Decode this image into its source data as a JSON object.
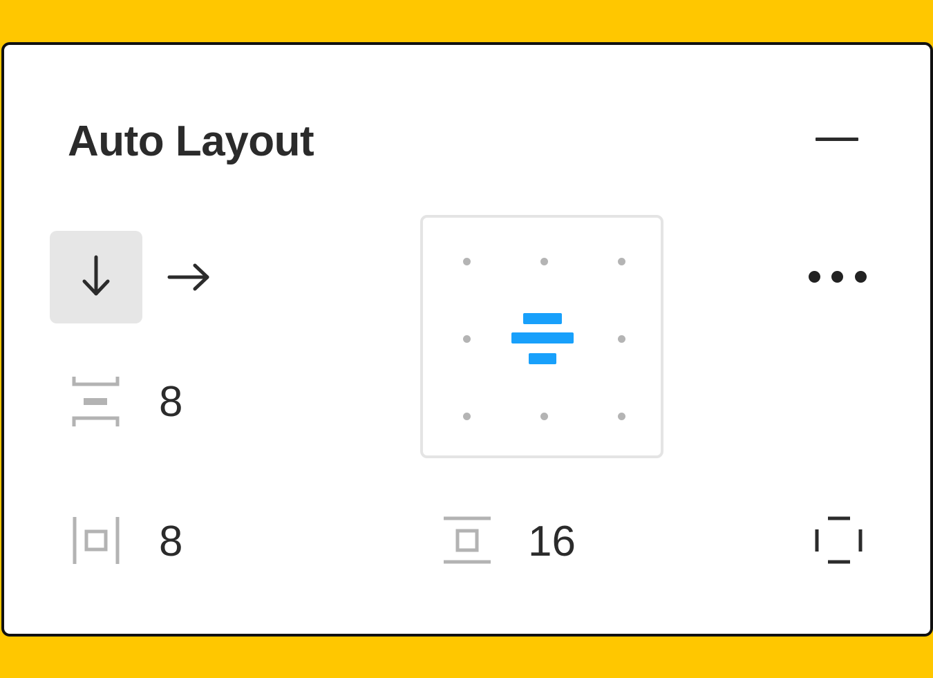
{
  "panel": {
    "title": "Auto Layout"
  },
  "icons": {
    "collapse": "minus-icon",
    "direction_vertical": "arrow-down-icon",
    "direction_horizontal": "arrow-right-icon",
    "spacing": "spacing-between-items-icon",
    "horizontal_padding": "horizontal-padding-icon",
    "vertical_padding": "vertical-padding-icon",
    "more": "more-options-icon",
    "individual_padding": "individual-padding-icon"
  },
  "direction": {
    "selected": "vertical"
  },
  "spacing": {
    "value": "8"
  },
  "padding": {
    "horizontal": "8",
    "vertical": "16"
  },
  "alignment": {
    "selected": "center",
    "grid": [
      "top-left",
      "top-center",
      "top-right",
      "center-left",
      "center",
      "center-right",
      "bottom-left",
      "bottom-center",
      "bottom-right"
    ]
  },
  "colors": {
    "background": "#FFC700",
    "panel": "#FFFFFF",
    "accent": "#18A0FB",
    "text": "#2B2B2B",
    "selected_bg": "#E6E6E6",
    "muted_icon": "#B3B3B3"
  }
}
